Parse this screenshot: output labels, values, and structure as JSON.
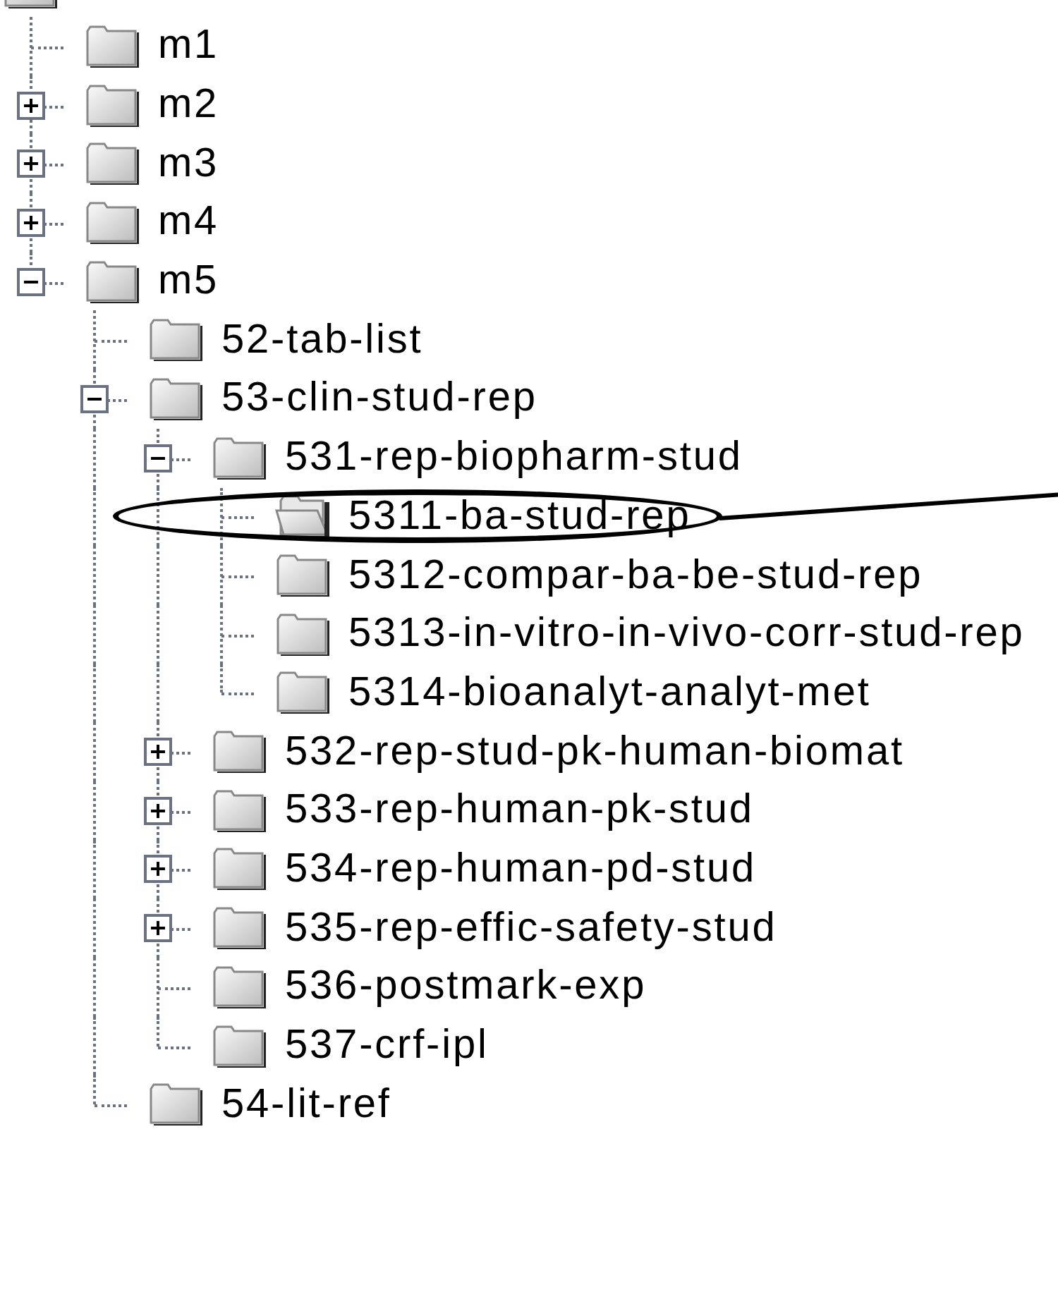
{
  "tree": {
    "children": [
      {
        "label": "m1",
        "open": false,
        "circled": false
      },
      {
        "label": "m2",
        "open": false,
        "circled": false,
        "expanded": false
      },
      {
        "label": "m3",
        "open": false,
        "circled": false,
        "expanded": false
      },
      {
        "label": "m4",
        "open": false,
        "circled": false,
        "expanded": false
      },
      {
        "label": "m5",
        "open": false,
        "circled": false,
        "expanded": true,
        "children": [
          {
            "label": "52-tab-list",
            "open": false,
            "circled": false
          },
          {
            "label": "53-clin-stud-rep",
            "open": false,
            "circled": false,
            "expanded": true,
            "children": [
              {
                "label": "531-rep-biopharm-stud",
                "open": false,
                "circled": false,
                "expanded": true,
                "children": [
                  {
                    "label": "5311-ba-stud-rep",
                    "open": true,
                    "circled": true
                  },
                  {
                    "label": "5312-compar-ba-be-stud-rep",
                    "open": false,
                    "circled": false
                  },
                  {
                    "label": "5313-in-vitro-in-vivo-corr-stud-rep",
                    "open": false,
                    "circled": false
                  },
                  {
                    "label": "5314-bioanalyt-analyt-met",
                    "open": false,
                    "circled": false
                  }
                ]
              },
              {
                "label": "532-rep-stud-pk-human-biomat",
                "open": false,
                "circled": false,
                "expanded": false
              },
              {
                "label": "533-rep-human-pk-stud",
                "open": false,
                "circled": false,
                "expanded": false
              },
              {
                "label": "534-rep-human-pd-stud",
                "open": false,
                "circled": false,
                "expanded": false
              },
              {
                "label": "535-rep-effic-safety-stud",
                "open": false,
                "circled": false,
                "expanded": false
              },
              {
                "label": "536-postmark-exp",
                "open": false,
                "circled": false
              },
              {
                "label": "537-crf-ipl",
                "open": false,
                "circled": false
              }
            ]
          },
          {
            "label": "54-lit-ref",
            "open": false,
            "circled": false
          }
        ]
      }
    ]
  }
}
